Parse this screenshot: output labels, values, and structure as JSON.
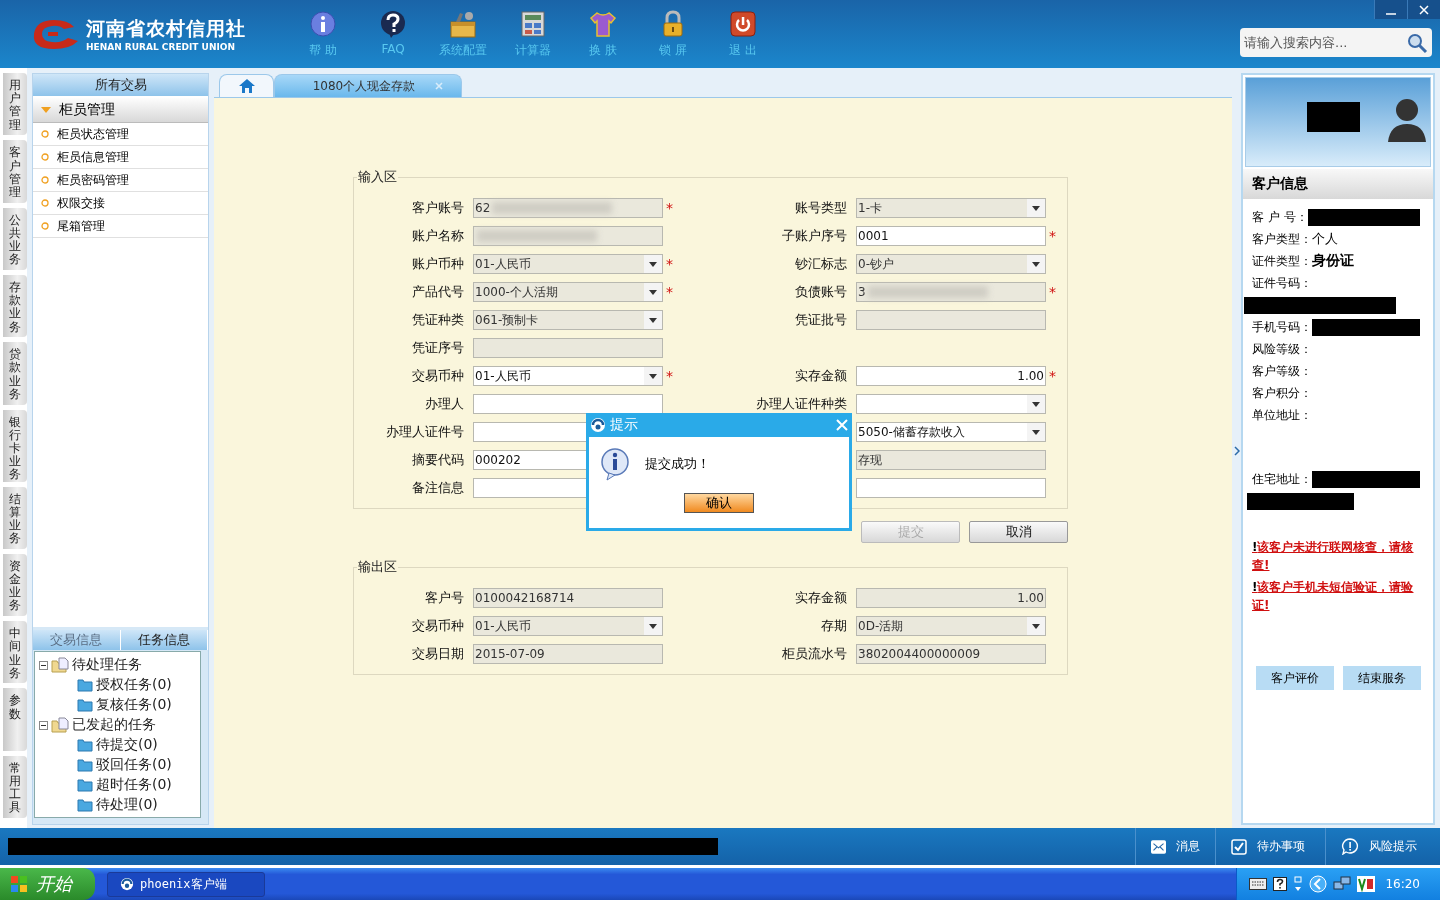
{
  "header": {
    "logo_title": "河南省农村信用社",
    "logo_subtitle": "HENAN RURAL CREDIT UNION",
    "toolbar": [
      {
        "kind": "help",
        "label": "帮 助"
      },
      {
        "kind": "faq",
        "label": "FAQ"
      },
      {
        "kind": "config",
        "label": "系统配置"
      },
      {
        "kind": "calculator",
        "label": "计算器"
      },
      {
        "kind": "skin",
        "label": "换 肤"
      },
      {
        "kind": "lock",
        "label": "锁 屏"
      },
      {
        "kind": "exit",
        "label": "退 出"
      }
    ],
    "search": {
      "placeholder": "请输入搜索内容..."
    }
  },
  "nav_tabs": [
    "用户管理",
    "客户管理",
    "公共业务",
    "存款业务",
    "贷款业务",
    "银行卡业务",
    "结算业务",
    "资金业务",
    "中间业务",
    "参数",
    "常用工具"
  ],
  "menu": {
    "title": "所有交易",
    "group": {
      "label": "柜员管理",
      "expanded": true,
      "items": [
        "柜员状态管理",
        "柜员信息管理",
        "柜员密码管理",
        "权限交接",
        "尾箱管理"
      ]
    },
    "tabs": [
      {
        "label": "交易信息",
        "selected": false
      },
      {
        "label": "任务信息",
        "selected": true
      }
    ],
    "tree": [
      {
        "label": "待处理任务",
        "expanded": true,
        "children": [
          {
            "label": "授权任务(0)"
          },
          {
            "label": "复核任务(0)"
          }
        ]
      },
      {
        "label": "已发起的任务",
        "expanded": true,
        "children": [
          {
            "label": "待提交(0)"
          },
          {
            "label": "驳回任务(0)"
          },
          {
            "label": "超时任务(0)"
          },
          {
            "label": "待处理(0)"
          }
        ]
      }
    ]
  },
  "work_tabs": [
    {
      "kind": "home",
      "selected": false
    },
    {
      "kind": "page",
      "label": "1080个人现金存款",
      "selected": true
    }
  ],
  "input_area": {
    "title": "输入区",
    "rows": [
      [
        {
          "label": "客户账号",
          "value": "62",
          "kind": "text",
          "disabled": true,
          "blurred": true,
          "marker": "*"
        },
        {
          "label": "账号类型",
          "value": "1-卡",
          "kind": "select",
          "disabled": true,
          "blurred": false
        }
      ],
      [
        {
          "label": "账户名称",
          "kind": "text",
          "disabled": true,
          "blurred": true
        },
        {
          "label": "子账户序号",
          "value": "0001",
          "kind": "text",
          "disabled": false,
          "blurred": false,
          "marker": "*"
        }
      ],
      [
        {
          "label": "账户币种",
          "value": "01-人民币",
          "kind": "select",
          "disabled": true,
          "blurred": false,
          "marker": "*"
        },
        {
          "label": "钞汇标志",
          "value": "0-钞户",
          "kind": "select",
          "disabled": true,
          "blurred": false
        }
      ],
      [
        {
          "label": "产品代号",
          "value": "1000-个人活期",
          "kind": "select",
          "disabled": true,
          "blurred": false,
          "marker": "*"
        },
        {
          "label": "负债账号",
          "value": "3",
          "kind": "text",
          "disabled": true,
          "blurred": true,
          "marker": "*"
        }
      ],
      [
        {
          "label": "凭证种类",
          "value": "061-预制卡",
          "kind": "select",
          "disabled": true,
          "blurred": false
        },
        {
          "label": "凭证批号",
          "kind": "text",
          "disabled": true,
          "blurred": false
        }
      ],
      [
        {
          "label": "凭证序号",
          "kind": "text",
          "disabled": true,
          "blurred": false
        }
      ],
      [
        {
          "label": "交易币种",
          "value": "01-人民币",
          "kind": "select",
          "disabled": false,
          "blurred": false,
          "marker": "*"
        },
        {
          "label": "实存金额",
          "value": "1.00",
          "kind": "amount",
          "disabled": false,
          "blurred": false,
          "marker": "*"
        }
      ],
      [
        {
          "label": "办理人",
          "kind": "text",
          "disabled": false,
          "blurred": false
        },
        {
          "label": "办理人证件种类",
          "kind": "select",
          "disabled": false,
          "blurred": false
        }
      ],
      [
        {
          "label": "办理人证件号",
          "kind": "text",
          "disabled": false,
          "blurred": false
        },
        {
          "value": "5050-储蓄存款收入",
          "kind": "select",
          "disabled": false,
          "blurred": false
        }
      ],
      [
        {
          "label": "摘要代码",
          "value": "000202",
          "kind": "text",
          "disabled": false,
          "blurred": false
        },
        {
          "value": "存现",
          "kind": "text",
          "disabled": true,
          "blurred": false
        }
      ],
      [
        {
          "label": "备注信息",
          "kind": "text",
          "disabled": false,
          "blurred": false
        },
        {
          "kind": "text",
          "disabled": false,
          "blurred": false
        }
      ]
    ]
  },
  "buttons": [
    {
      "label": "提交",
      "disabled": true
    },
    {
      "label": "取消",
      "disabled": false
    }
  ],
  "output_area": {
    "title": "输出区",
    "rows": [
      [
        {
          "label": "客户号",
          "value": "0100042168714",
          "kind": "text",
          "disabled": true,
          "blurred": false
        },
        {
          "label": "实存金额",
          "value": "1.00",
          "kind": "amount",
          "disabled": true,
          "blurred": false
        }
      ],
      [
        {
          "label": "交易币种",
          "value": "01-人民币",
          "kind": "select",
          "disabled": true,
          "blurred": false
        },
        {
          "label": "存期",
          "value": "0D-活期",
          "kind": "select",
          "disabled": true,
          "blurred": false
        }
      ],
      [
        {
          "label": "交易日期",
          "value": "2015-07-09",
          "kind": "text",
          "disabled": true,
          "blurred": false
        },
        {
          "label": "柜员流水号",
          "value": "3802004400000009",
          "kind": "text",
          "disabled": true,
          "blurred": false
        }
      ]
    ]
  },
  "dialog": {
    "title": "提示",
    "message": "提交成功！",
    "button": "确认"
  },
  "customer_info": {
    "title": "客户信息",
    "rows": [
      {
        "label": "客 户 号：",
        "kind": "bar"
      },
      {
        "label": "客户类型：",
        "kind": "value",
        "value": "个人",
        "strong": false
      },
      {
        "label": "证件类型：",
        "kind": "value",
        "value": "身份证",
        "strong": true
      },
      {
        "label": "证件号码：",
        "kind": "bar_below"
      },
      {
        "label": "手机号码：",
        "kind": "bar"
      },
      {
        "label": "风险等级：",
        "kind": "empty"
      },
      {
        "label": "客户等级：",
        "kind": "empty"
      },
      {
        "label": "客户积分：",
        "kind": "empty"
      },
      {
        "label": "单位地址：",
        "kind": "address"
      },
      {
        "label": "住宅地址：",
        "kind": "bar_wrap"
      }
    ],
    "warnings": [
      {
        "mark": "!",
        "text": "该客户未进行联网核查，请核查!"
      },
      {
        "mark": "!",
        "text": "该客户手机未短信验证，请验证!"
      }
    ],
    "buttons": [
      "客户评价",
      "结束服务"
    ]
  },
  "status_bar": {
    "items": [
      {
        "kind": "message",
        "label": "消息"
      },
      {
        "kind": "todo",
        "label": "待办事项"
      },
      {
        "kind": "risk",
        "label": "风险提示"
      }
    ]
  },
  "taskbar": {
    "start": "开始",
    "tasks": [
      "phoenix客户端"
    ],
    "clock": "16:20"
  }
}
